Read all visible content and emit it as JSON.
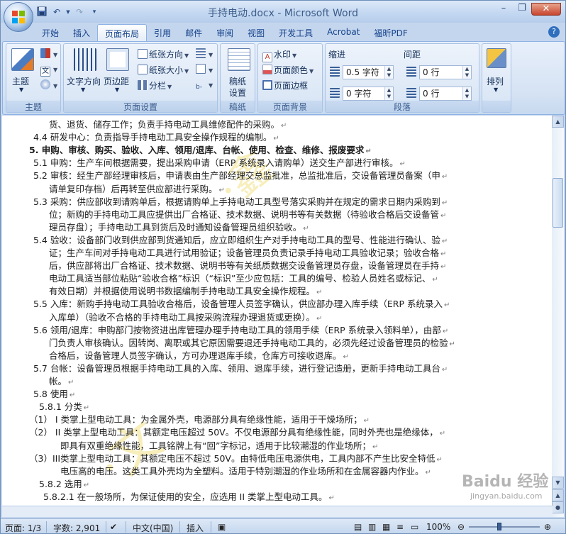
{
  "window": {
    "title": "手持电动.docx - Microsoft Word",
    "help": "?"
  },
  "qat": {
    "save_icon": "save-icon",
    "undo_icon": "undo-icon",
    "redo_icon": "redo-icon",
    "customize_icon": "customize-icon"
  },
  "tabs": [
    "开始",
    "插入",
    "页面布局",
    "引用",
    "邮件",
    "审阅",
    "视图",
    "开发工具",
    "Acrobat",
    "福昕PDF"
  ],
  "active_tab": "页面布局",
  "ribbon": {
    "theme": {
      "label": "主题",
      "btn": "主题"
    },
    "page_setup": {
      "label": "页面设置",
      "text_dir": "文字方向",
      "margins": "页边距",
      "orientation": "纸张方向",
      "size": "纸张大小",
      "columns": "分栏"
    },
    "draft": {
      "label": "稿纸",
      "btn1": "稿纸",
      "btn2": "设置"
    },
    "background": {
      "label": "页面背景",
      "watermark": "水印",
      "page_color": "页面颜色",
      "page_border": "页面边框"
    },
    "paragraph": {
      "label": "段落",
      "indent": "缩进",
      "spacing": "间距",
      "indent_left": "0.5 字符",
      "indent_right": "0 字符",
      "space_before": "0 行",
      "space_after": "0 行"
    },
    "arrange": {
      "label": "排列",
      "btn": "排列"
    }
  },
  "document": {
    "lines": [
      {
        "text": "货、退货、储存工作；负责手持电动工具维修配件的采购。",
        "indent": 66,
        "bold": false
      },
      {
        "text": "4.4 研发中心：负责指导手持电动工具安全操作规程的编制。",
        "indent": 44,
        "bold": false
      },
      {
        "text": "5. 申购、审核、购买、验收、入库、领用/退库、台帐、使用、检查、维修、报废要求",
        "indent": 38,
        "bold": true
      },
      {
        "text": "5.1 申购：生产车间根据需要，提出采购申请（ERP 系统录入请购单）送交生产部进行审核。",
        "indent": 44,
        "bold": false
      },
      {
        "text": "5.2 审核：经生产部经理审核后，申请表由生产部经理交总监批准，总监批准后，交设备管理员备案（申",
        "indent": 44,
        "bold": false
      },
      {
        "text": "请单复印存档）后再转至供应部进行采购。",
        "indent": 66,
        "bold": false
      },
      {
        "text": "5.3 采购：供应部收到请购单后，根据请购单上手持电动工具型号落实采购并在规定的需求日期内采购到",
        "indent": 44,
        "bold": false
      },
      {
        "text": "位；新购的手持电动工具应提供出厂合格证、技术数据、说明书等有关数据（待验收合格后交设备管",
        "indent": 66,
        "bold": false
      },
      {
        "text": "理员存盘）；手持电动工具到货后及时通知设备管理员组织验收。",
        "indent": 66,
        "bold": false
      },
      {
        "text": "5.4 验收：设备部门收到供应部到货通知后，应立即组织生产对手持电动工具的型号、性能进行确认、验",
        "indent": 44,
        "bold": false
      },
      {
        "text": "证；生产车间对手持电动工具进行试用验证；设备管理员负责记录手持电动工具验收记录；验收合格",
        "indent": 66,
        "bold": false
      },
      {
        "text": "后，供应部将出厂合格证、技术数据、说明书等有关纸质数据交设备管理员存盘，设备管理员在手持",
        "indent": 66,
        "bold": false
      },
      {
        "text": "电动工具适当部位粘贴“验收合格”标识（“标识”至少应包括：工具的编号、检验人员姓名或标记、",
        "indent": 66,
        "bold": false
      },
      {
        "text": "有效日期）并根据使用说明书数据编制手持电动工具安全操作规程。",
        "indent": 66,
        "bold": false
      },
      {
        "text": "5.5 入库：新购手持电动工具验收合格后，设备管理人员签字确认，供应部办理入库手续（ERP 系统录入",
        "indent": 44,
        "bold": false
      },
      {
        "text": "入库单）（验收不合格的手持电动工具按采购流程办理退货或更换）。",
        "indent": 66,
        "bold": false
      },
      {
        "text": "5.6 领用/退库：申购部门按物资进出库管理办理手持电动工具的领用手续（ERP 系统录入领料单），由部",
        "indent": 44,
        "bold": false
      },
      {
        "text": "门负责人审核确认。因转岗、离职或其它原因需要退还手持电动工具的，必须先经过设备管理员的检验",
        "indent": 66,
        "bold": false
      },
      {
        "text": "合格后，设备管理人员签字确认，方可办理退库手续，仓库方可接收退库。",
        "indent": 66,
        "bold": false
      },
      {
        "text": "5.7 台帐：设备管理员根据手持电动工具的入库、领用、退库手续，进行登记造册，更新手持电动工具台",
        "indent": 44,
        "bold": false
      },
      {
        "text": "帐。",
        "indent": 66,
        "bold": false
      },
      {
        "text": "5.8 使用",
        "indent": 44,
        "bold": false
      },
      {
        "text": "5.8.1 分类",
        "indent": 52,
        "bold": false
      },
      {
        "text": "（1） I 类掌上型电动工具：为金属外壳，电源部分具有绝缘性能，适用于干燥场所；",
        "indent": 38,
        "bold": false
      },
      {
        "text": "（2） II 类掌上型电动工具：其额定电压超过 50V。不仅电源部分具有绝缘性能，同时外壳也是绝缘体，",
        "indent": 38,
        "bold": false
      },
      {
        "text": "即具有双重绝缘性能，工具铭牌上有“回”字标记，适用于比较潮湿的作业场所；",
        "indent": 82,
        "bold": false
      },
      {
        "text": "（3）III类掌上型电动工具：其额定电压不超过 50V。由特低电压电源供电，工具内部不产生比安全特低",
        "indent": 38,
        "bold": false
      },
      {
        "text": "电压高的电压。这类工具外壳均为全塑料。适用于特别潮湿的作业场所和在金属容器内作业。",
        "indent": 82,
        "bold": false
      },
      {
        "text": "5.8.2 选用",
        "indent": 52,
        "bold": false
      },
      {
        "text": "5.8.2.1 在一般场所，为保证使用的安全，应选用 II 类掌上型电动工具。",
        "indent": 58,
        "bold": false
      }
    ]
  },
  "status": {
    "page": "页面: 1/3",
    "words": "字数: 2,901",
    "lang": "中文(中国)",
    "mode": "插入",
    "zoom": "100%"
  },
  "watermark": {
    "brand": "Baidu 经验",
    "url": "jingyan.baidu.com"
  }
}
